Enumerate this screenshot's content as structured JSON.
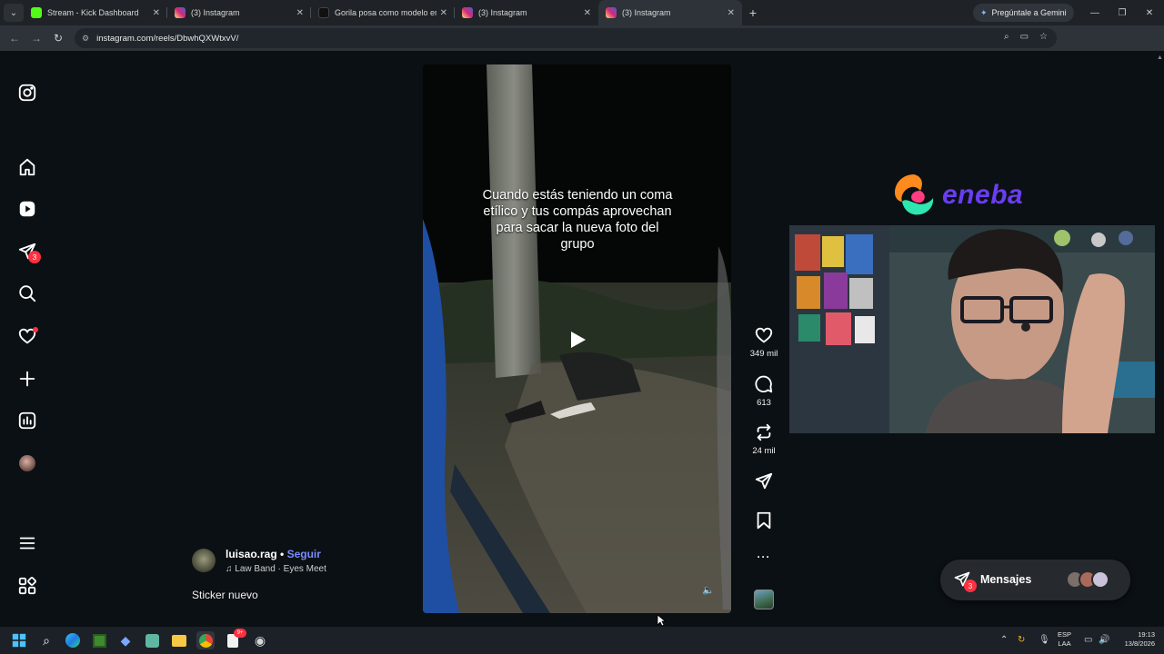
{
  "browser": {
    "tabs": [
      {
        "title": "Stream - Kick Dashboard",
        "favicon_color": "#53fc18",
        "active": false
      },
      {
        "title": "(3) Instagram",
        "favicon_color": "#d62976",
        "active": false
      },
      {
        "title": "Gorila posa como modelo en U",
        "favicon_color": "#111111",
        "active": false
      },
      {
        "title": "(3) Instagram",
        "favicon_color": "#d62976",
        "active": false
      },
      {
        "title": "(3) Instagram",
        "favicon_color": "#d62976",
        "active": true
      }
    ],
    "close_glyph": "✕",
    "new_tab_glyph": "+",
    "gemini_label": "Pregúntale a Gemini",
    "url": "instagram.com/reels/DbwhQXWtxvV/"
  },
  "sidebar": {
    "messages_badge": "3"
  },
  "reel": {
    "caption": "Cuando estás teniendo un coma etílico y tus compás aprovechan para sacar la nueva foto del grupo",
    "likes": "349 mil",
    "comments": "613",
    "reposts": "24 mil",
    "username": "luisao.rag",
    "separator": " • ",
    "follow_label": "Seguir",
    "song": "Law Band · Eyes Meet",
    "description": "Sticker nuevo",
    "more_glyph": "···"
  },
  "overlay": {
    "sponsor_text": "eneba"
  },
  "messages_panel": {
    "label": "Mensajes",
    "badge": "3"
  },
  "taskbar": {
    "lang_line1": "ESP",
    "lang_line2": "LAA",
    "time": "19:13",
    "date": "13/8/2026",
    "notif_badge": "9+"
  }
}
